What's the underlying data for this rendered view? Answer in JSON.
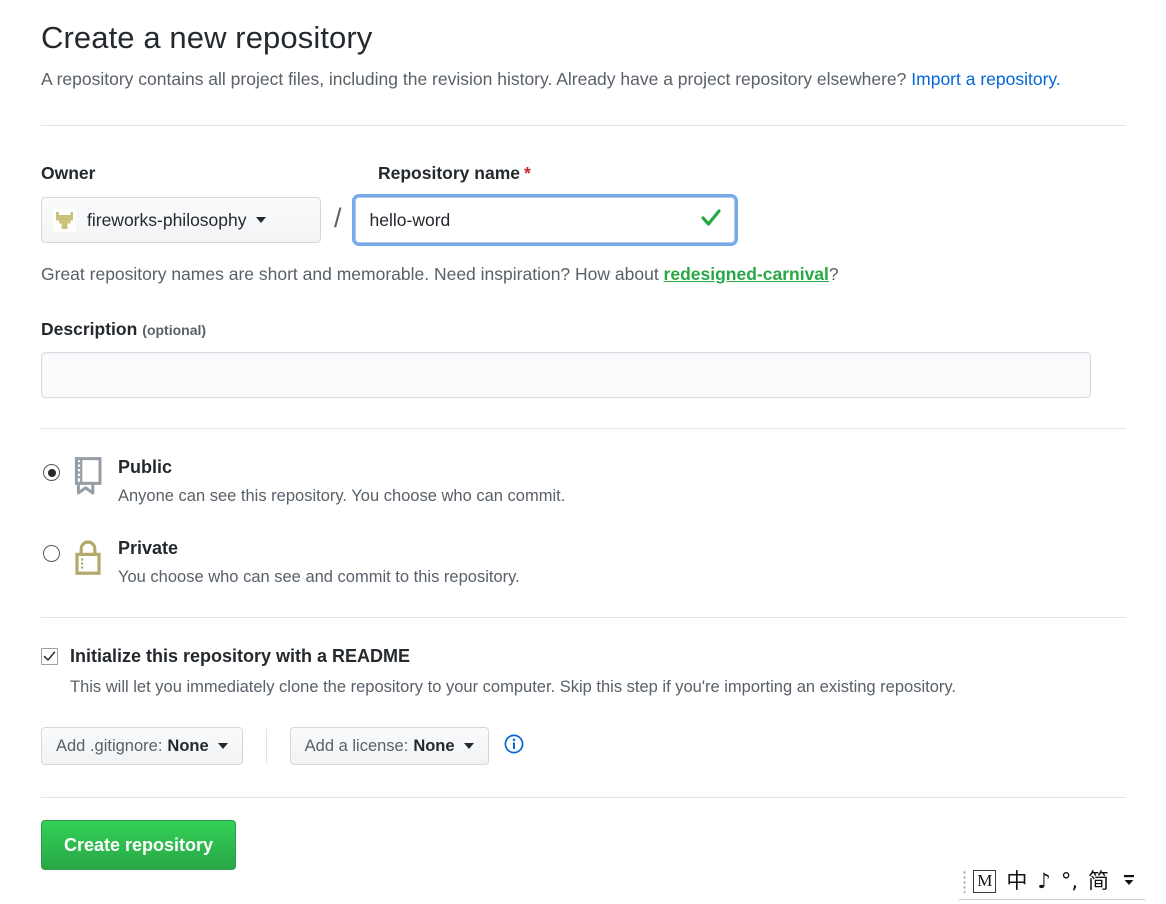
{
  "header": {
    "title": "Create a new repository",
    "description_part1": "A repository contains all project files, including the revision history. Already have a project repository elsewhere?",
    "import_link": "Import a repository."
  },
  "owner": {
    "label": "Owner",
    "name": "fireworks-philosophy",
    "avatar_icon": "identicon-avatar",
    "caret_icon": "chevron-down-icon",
    "separator": "/"
  },
  "repository_name": {
    "label": "Repository name",
    "required_marker": "*",
    "value": "hello-word",
    "placeholder": "",
    "validation_icon": "check-icon"
  },
  "hint": {
    "prefix": "Great repository names are short and memorable. Need inspiration? How about ",
    "suggestion": "redesigned-carnival",
    "suffix": "?"
  },
  "description": {
    "label": "Description",
    "optional": "(optional)",
    "value": "",
    "placeholder": ""
  },
  "visibility": {
    "options": [
      {
        "id": "public",
        "title": "Public",
        "description": "Anyone can see this repository. You choose who can commit.",
        "icon": "repo-book-icon",
        "selected": true
      },
      {
        "id": "private",
        "title": "Private",
        "description": "You choose who can see and commit to this repository.",
        "icon": "lock-icon",
        "selected": false
      }
    ]
  },
  "readme": {
    "checked": true,
    "checkbox_icon": "checkmark-icon",
    "title": "Initialize this repository with a README",
    "description": "This will let you immediately clone the repository to your computer. Skip this step if you're importing an existing repository."
  },
  "dropdowns": {
    "gitignore": {
      "prefix": "Add .gitignore:",
      "value": "None",
      "caret_icon": "chevron-down-icon"
    },
    "license": {
      "prefix": "Add a license:",
      "value": "None",
      "caret_icon": "chevron-down-icon"
    },
    "info_icon": "info-circle-icon"
  },
  "submit": {
    "label": "Create repository"
  },
  "ime_bar": {
    "grip_icon": "drag-grip-icon",
    "mode_label": "M",
    "items": [
      {
        "label": "中",
        "name": "chinese-mode-toggle"
      },
      {
        "label": "♪",
        "name": "sound-toggle"
      },
      {
        "label": "°,",
        "name": "punctuation-toggle"
      },
      {
        "label": "简",
        "name": "simplified-chinese-toggle"
      }
    ],
    "expand_icon": "expand-collapse-icon"
  },
  "colors": {
    "accent_blue": "#0366d6",
    "success_green": "#28a745",
    "required_red": "#cb2431",
    "muted_text": "#586069",
    "border": "#e1e4e8",
    "avatar_gold": "#ccc17a"
  }
}
